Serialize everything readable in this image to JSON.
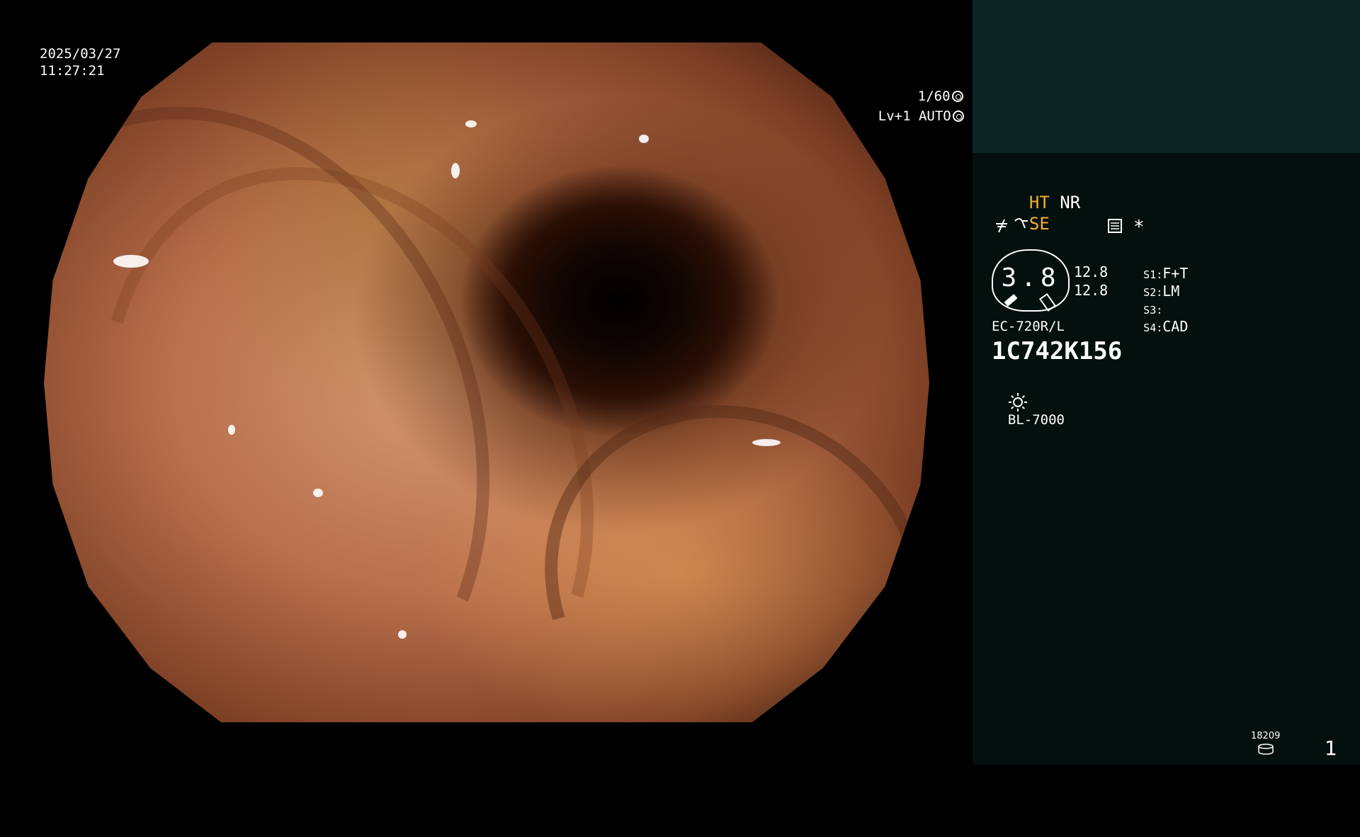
{
  "timestamp": {
    "date": "2025/03/27",
    "time": "11:27:21"
  },
  "exposure": {
    "shutter": "1/60",
    "level": "Lv+1 AUTO"
  },
  "panel": {
    "mode_row1": {
      "ht": "HT",
      "nr": "NR"
    },
    "mode_row2": {
      "se": "SE"
    },
    "gauge_value": "3.8",
    "gauge_side_values": [
      "12.8",
      "12.8"
    ],
    "presets": [
      {
        "key": "S1:",
        "value": "F+T"
      },
      {
        "key": "S2:",
        "value": "LM"
      },
      {
        "key": "S3:",
        "value": ""
      },
      {
        "key": "S4:",
        "value": "CAD"
      }
    ],
    "scope_model": "EC-720R/L",
    "serial": "1C742K156",
    "light_source": "BL-7000",
    "asterisk": "*",
    "counter": "18209",
    "page_number": "1"
  },
  "colors": {
    "panel_bg": "#03100e",
    "panel_top_bg": "#0c2523",
    "mode_highlight": "#f0b030"
  },
  "icons": [
    "shutter-icon",
    "iris-icon",
    "bend-icon",
    "slash-icon",
    "memo-icon",
    "sun-icon",
    "disk-icon"
  ]
}
